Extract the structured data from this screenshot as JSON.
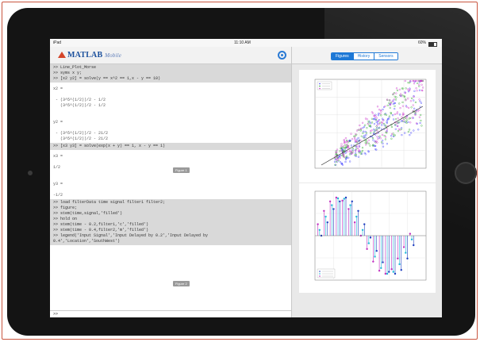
{
  "status": {
    "carrier": "iPad",
    "time": "11:10 AM",
    "battery": "60%"
  },
  "app": {
    "logo": "MATLAB",
    "logo_suffix": "Mobile"
  },
  "tabs": [
    {
      "label": "Figures",
      "active": true
    },
    {
      "label": "History",
      "active": false
    },
    {
      "label": "Sensors",
      "active": false
    }
  ],
  "console": {
    "blocks": [
      {
        "type": "cmd",
        "text": ">> Line_Plot_Morse\n>> syms x y;\n>> [x2 y2] = solve(y == x^2 == 1,x - y == 10)"
      },
      {
        "type": "out",
        "text": "x2 =\n\n - (3^5^(1/2))/2 - 1/2\n   (3^5^(1/2))/2 - 1/2\n\n\ny2 =\n\n - (3^5^(1/2))/2 - 21/2\n   (3^5^(1/2))/2 - 21/2\n"
      },
      {
        "type": "cmd",
        "text": ">> [x3 y3] = solve(exp(x + y) == 1, x - y == 1)"
      },
      {
        "type": "out",
        "text": "x3 =\n\n1/2\n\n\ny3 =\n\n-1/2\n"
      },
      {
        "type": "cmd",
        "text": ">> load filterData time signal filter1 filter2;\n>> figure;\n>> stem(time,signal,'filled')\n>> hold on\n>> stem(time - 0.2,filter1,'c','filled')\n>> stem(time - 0.4,filter2,'m','filled')\n>> legend('Input Signal','Input Delayed by 0.2','Input Delayed by\n0.4','Location','SouthWest')"
      }
    ],
    "prompt": ">>"
  },
  "figures": [
    {
      "label": "Figure 1"
    },
    {
      "label": "Figure 2"
    }
  ],
  "colors": {
    "accent": "#1d78d6",
    "command_bg": "#d9d9d9",
    "logo_red": "#d4452a"
  },
  "chart_data": [
    {
      "type": "scatter",
      "series": [
        {
          "color": "#3b3bff"
        },
        {
          "color": "#2ea82e"
        },
        {
          "color": "#cc33cc"
        }
      ],
      "fit_line": true,
      "grid": true,
      "legend": "top-left"
    },
    {
      "type": "stem",
      "series": [
        {
          "color": "#1f3fbf",
          "values": [
            0,
            0.35,
            0.7,
            0.9,
            1.0,
            0.9,
            0.65,
            0.3,
            -0.05,
            -0.4,
            -0.7,
            -0.95,
            -1.0,
            -0.9,
            -0.6,
            -0.25
          ]
        },
        {
          "color": "#20b8d8",
          "values": [
            0.15,
            0.5,
            0.8,
            0.98,
            0.97,
            0.8,
            0.5,
            0.15,
            -0.2,
            -0.55,
            -0.85,
            -1.0,
            -0.95,
            -0.75,
            -0.45,
            -0.1
          ]
        },
        {
          "color": "#c030c0",
          "values": [
            0.3,
            0.65,
            0.9,
            1.0,
            0.92,
            0.7,
            0.35,
            0.0,
            -0.35,
            -0.68,
            -0.92,
            -1.0,
            -0.88,
            -0.6,
            -0.3,
            0.05
          ]
        }
      ],
      "grid": true,
      "legend": "bottom-left"
    }
  ]
}
